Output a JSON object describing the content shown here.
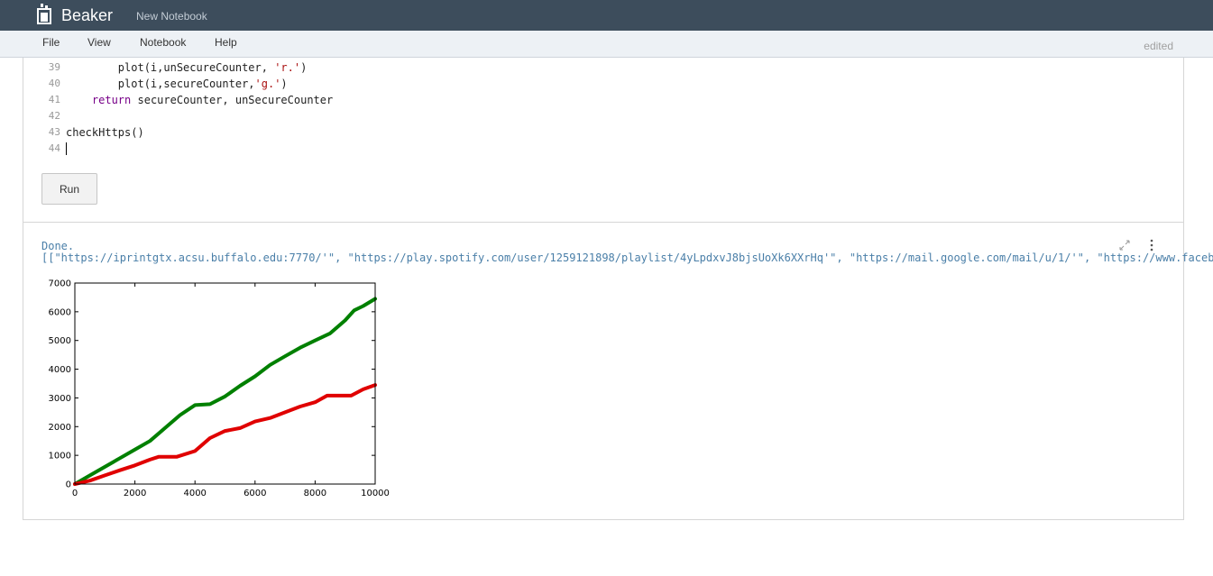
{
  "header": {
    "app_title": "Beaker",
    "notebook_title": "New Notebook"
  },
  "menu": {
    "items": [
      "File",
      "View",
      "Notebook",
      "Help"
    ],
    "status": "edited"
  },
  "code_lines": [
    {
      "n": "39",
      "parts": [
        {
          "t": "        plot(i,unSecureCounter, ",
          "c": ""
        },
        {
          "t": "'r.'",
          "c": "str"
        },
        {
          "t": ")",
          "c": ""
        }
      ]
    },
    {
      "n": "40",
      "parts": [
        {
          "t": "        plot(i,secureCounter,",
          "c": ""
        },
        {
          "t": "'g.'",
          "c": "str"
        },
        {
          "t": ")",
          "c": ""
        }
      ]
    },
    {
      "n": "41",
      "parts": [
        {
          "t": "    ",
          "c": ""
        },
        {
          "t": "return",
          "c": "kw"
        },
        {
          "t": " secureCounter, unSecureCounter",
          "c": ""
        }
      ]
    },
    {
      "n": "42",
      "parts": []
    },
    {
      "n": "43",
      "parts": [
        {
          "t": "checkHttps()",
          "c": ""
        }
      ]
    },
    {
      "n": "44",
      "parts": [],
      "cursor": true
    }
  ],
  "run_button": "Run",
  "output": {
    "status": "Done.",
    "result": "[[\"https://iprintgtx.acsu.buffalo.edu:7770/'\", \"https://play.spotify.com/user/1259121898/playlist/4yLpdxvJ8bjsUoXk6XXrHq'\", \"https://mail.google.com/mail/u/1/'\", \"https://www.facebo"
  },
  "icons": {
    "expand": "expand-icon",
    "menu": "vertical-dots-icon"
  },
  "chart_data": {
    "type": "line",
    "title": "",
    "xlabel": "",
    "ylabel": "",
    "xlim": [
      0,
      10000
    ],
    "ylim": [
      0,
      7000
    ],
    "xticks": [
      0,
      2000,
      4000,
      6000,
      8000,
      10000
    ],
    "yticks": [
      0,
      1000,
      2000,
      3000,
      4000,
      5000,
      6000,
      7000
    ],
    "grid": false,
    "series": [
      {
        "color": "#008000",
        "points": [
          [
            0,
            0
          ],
          [
            500,
            300
          ],
          [
            1000,
            600
          ],
          [
            1500,
            900
          ],
          [
            2000,
            1200
          ],
          [
            2500,
            1500
          ],
          [
            3000,
            1950
          ],
          [
            3500,
            2400
          ],
          [
            4000,
            2750
          ],
          [
            4500,
            2780
          ],
          [
            5000,
            3050
          ],
          [
            5500,
            3420
          ],
          [
            6000,
            3750
          ],
          [
            6500,
            4150
          ],
          [
            7000,
            4450
          ],
          [
            7500,
            4750
          ],
          [
            8000,
            5000
          ],
          [
            8500,
            5250
          ],
          [
            9000,
            5700
          ],
          [
            9300,
            6050
          ],
          [
            9600,
            6200
          ],
          [
            10000,
            6450
          ]
        ]
      },
      {
        "color": "#e00000",
        "points": [
          [
            0,
            0
          ],
          [
            500,
            120
          ],
          [
            1000,
            300
          ],
          [
            1500,
            480
          ],
          [
            2000,
            650
          ],
          [
            2500,
            850
          ],
          [
            2800,
            950
          ],
          [
            3400,
            950
          ],
          [
            4000,
            1150
          ],
          [
            4500,
            1600
          ],
          [
            5000,
            1850
          ],
          [
            5500,
            1950
          ],
          [
            6000,
            2180
          ],
          [
            6500,
            2300
          ],
          [
            7000,
            2500
          ],
          [
            7500,
            2700
          ],
          [
            8000,
            2850
          ],
          [
            8400,
            3080
          ],
          [
            9200,
            3080
          ],
          [
            9600,
            3300
          ],
          [
            10000,
            3450
          ]
        ]
      }
    ]
  }
}
